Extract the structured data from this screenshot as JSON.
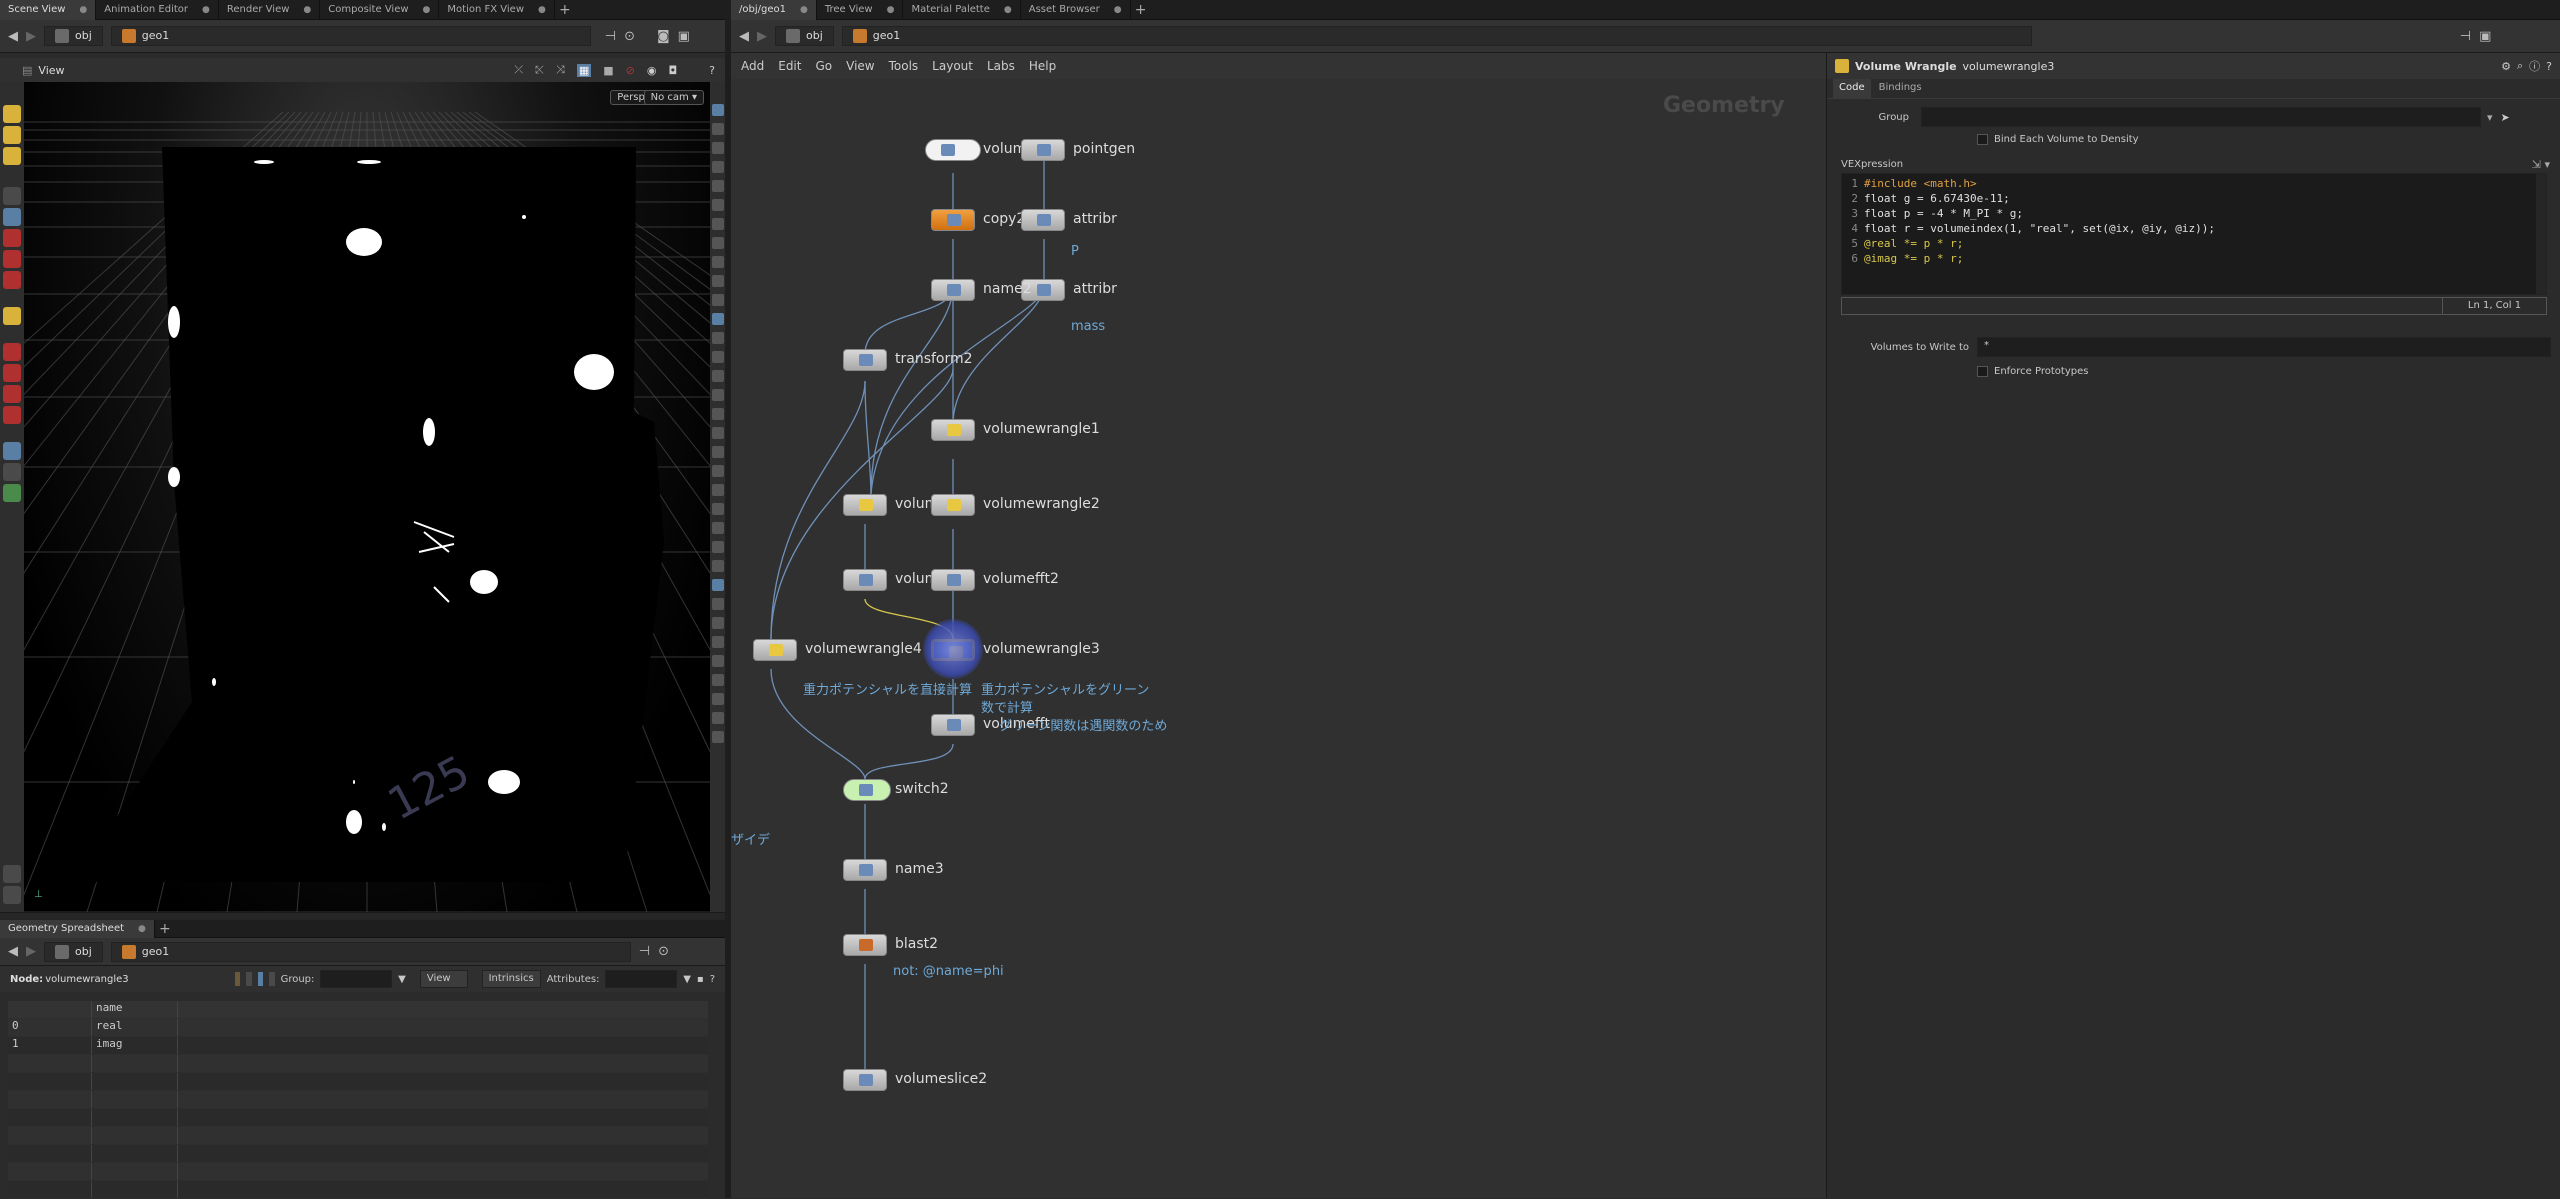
{
  "left_tabs": [
    {
      "label": "Scene View",
      "active": true
    },
    {
      "label": "Animation Editor",
      "active": false
    },
    {
      "label": "Render View",
      "active": false
    },
    {
      "label": "Composite View",
      "active": false
    },
    {
      "label": "Motion FX View",
      "active": false
    }
  ],
  "right_tabs": [
    {
      "label": "/obj/geo1",
      "active": true
    },
    {
      "label": "Tree View",
      "active": false
    },
    {
      "label": "Material Palette",
      "active": false
    },
    {
      "label": "Asset Browser",
      "active": false
    }
  ],
  "path": {
    "obj": "obj",
    "geo": "geo1"
  },
  "viewport": {
    "title": "View",
    "persp": "Persp ▾",
    "cam": "No cam ▾",
    "floor_label": "125",
    "colors": {
      "bg": "#000000",
      "grid": "#555555",
      "blob": "#ffffff"
    }
  },
  "network_menu": [
    "Add",
    "Edit",
    "Go",
    "View",
    "Tools",
    "Layout",
    "Labs",
    "Help"
  ],
  "network": {
    "context_label": "Geometry",
    "nodes": [
      {
        "name": "volume2"
      },
      {
        "name": "pointgen"
      },
      {
        "name": "copy2"
      },
      {
        "name": "attribr"
      },
      {
        "name": "attribr"
      },
      {
        "name": "name2"
      },
      {
        "name": "transform2"
      },
      {
        "name": "volumewrangle1"
      },
      {
        "name": "volumefr"
      },
      {
        "name": "volumewrangle2"
      },
      {
        "name": "volumefft"
      },
      {
        "name": "volumefft2"
      },
      {
        "name": "volumewrangle4"
      },
      {
        "name": "volumewrangle3"
      },
      {
        "name": "volumefft"
      },
      {
        "name": "switch2"
      },
      {
        "name": "name3"
      },
      {
        "name": "blast2"
      },
      {
        "name": "volumeslice2"
      }
    ],
    "subs": {
      "p": "P",
      "mass": "mass",
      "vw4": "重力ポテンシャルを直接計算",
      "vw3_line1": "重力ポテンシャルをグリーン",
      "vw3_line2": "数で計算",
      "vw3_line3": "グリーン関数は遇関数のため",
      "blast": "not: @name=phi",
      "side": "ザイデ"
    }
  },
  "params": {
    "node_type": "Volume Wrangle",
    "node_name": "volumewrangle3",
    "tabs": [
      "Code",
      "Bindings"
    ],
    "group_label": "Group",
    "group_value": "",
    "bind_label": "Bind Each Volume to Density",
    "vex_label": "VEXpression",
    "code_lines": [
      "#include <math.h>",
      "float g = 6.67430e-11;",
      "float p = -4 * M_PI * g;",
      "float r = volumeindex(1, \"real\", set(@ix, @iy, @iz));",
      "@real *= p * r;",
      "@imag *= p * r;"
    ],
    "cursor": "Ln 1, Col 1",
    "volumes_label": "Volumes to Write to",
    "volumes_value": "*",
    "enforce_label": "Enforce Prototypes"
  },
  "spreadsheet": {
    "tab": "Geometry Spreadsheet",
    "node_label": "Node:",
    "node_value": "volumewrangle3",
    "group_label": "Group:",
    "view_label": "View",
    "intrinsics_label": "Intrinsics",
    "attributes_label": "Attributes:",
    "columns": [
      "",
      "name"
    ],
    "rows": [
      [
        "0",
        "real"
      ],
      [
        "1",
        "imag"
      ]
    ]
  }
}
